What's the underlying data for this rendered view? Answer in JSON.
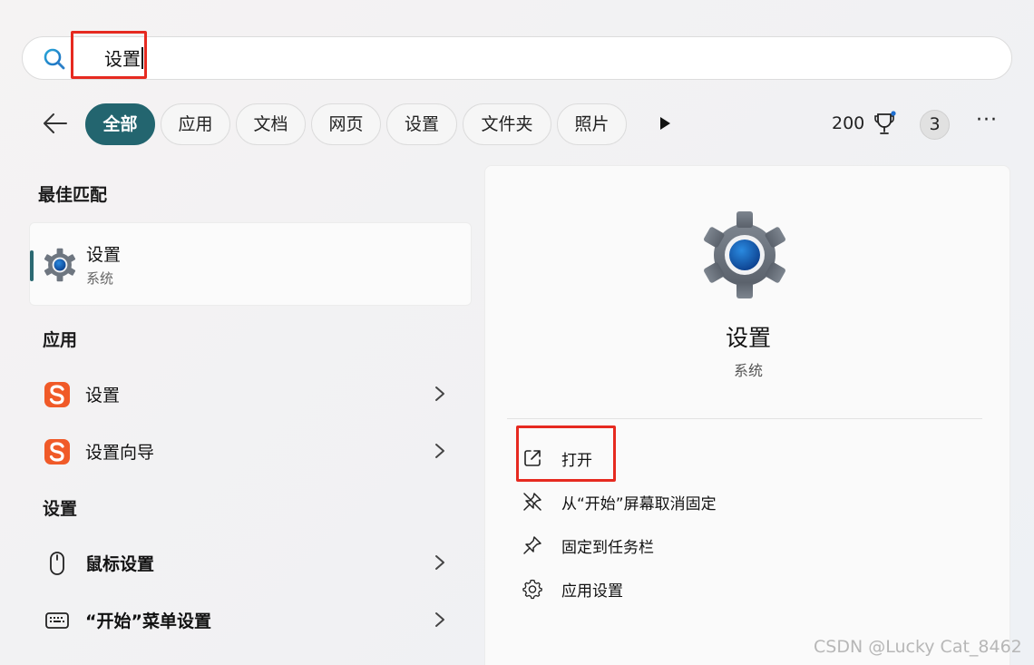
{
  "search": {
    "value": "设置"
  },
  "filters": {
    "chips": [
      "全部",
      "应用",
      "文档",
      "网页",
      "设置",
      "文件夹",
      "照片"
    ],
    "active_index": 0,
    "points": "200",
    "badge": "3",
    "more": "···"
  },
  "results": {
    "best_match_heading": "最佳匹配",
    "best_match": {
      "title": "设置",
      "subtitle": "系统",
      "icon": "settings-gear-icon"
    },
    "apps_heading": "应用",
    "apps": [
      {
        "label": "设置",
        "icon": "sogou-ime-icon"
      },
      {
        "label": "设置向导",
        "icon": "sogou-ime-icon"
      }
    ],
    "settings_heading": "设置",
    "settings": [
      {
        "label": "鼠标设置",
        "icon": "mouse-icon"
      },
      {
        "label": "“开始”菜单设置",
        "icon": "keyboard-icon"
      }
    ]
  },
  "detail": {
    "title": "设置",
    "subtitle": "系统",
    "actions": [
      {
        "label": "打开",
        "icon": "open-external-icon"
      },
      {
        "label": "从“开始”屏幕取消固定",
        "icon": "unpin-icon"
      },
      {
        "label": "固定到任务栏",
        "icon": "pin-icon"
      },
      {
        "label": "应用设置",
        "icon": "gear-outline-icon"
      }
    ]
  },
  "colors": {
    "accent": "#23656f",
    "highlight": "#e62a20",
    "sogou": "#f05a28"
  },
  "watermark": "CSDN @Lucky Cat_8462"
}
